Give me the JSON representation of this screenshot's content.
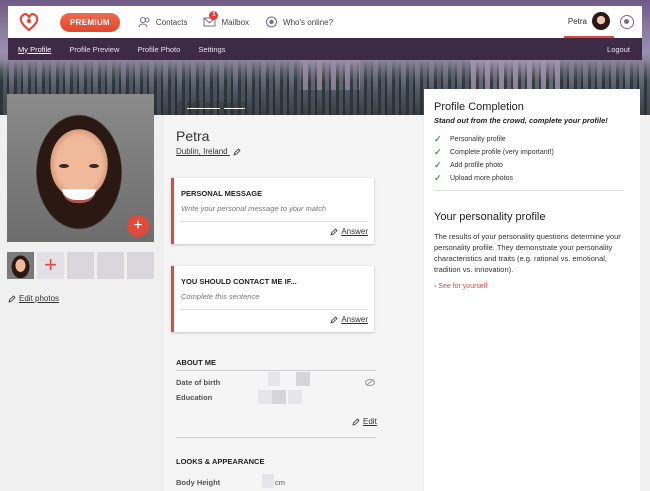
{
  "header": {
    "premium_label": "PREMIUM",
    "nav": [
      {
        "label": "Contacts",
        "icon": "contacts-icon"
      },
      {
        "label": "Mailbox",
        "icon": "mailbox-icon",
        "badge": "1"
      },
      {
        "label": "Who's online?",
        "icon": "whos-online-icon"
      }
    ],
    "user_name": "Petra"
  },
  "subnav": {
    "tabs": [
      "My Profile",
      "Profile Preview",
      "Profile Photo",
      "Settings"
    ],
    "logout": "Logout"
  },
  "profile": {
    "edit_background": "Edit background",
    "name": "Petra",
    "location": "Dublin, Ireland",
    "edit_photos": "Edit photos"
  },
  "cards": [
    {
      "title": "PERSONAL MESSAGE",
      "placeholder": "Write your personal message to your match",
      "action": "Answer"
    },
    {
      "title": "YOU SHOULD CONTACT ME IF...",
      "placeholder": "Complete this sentence",
      "action": "Answer"
    }
  ],
  "about": {
    "heading": "ABOUT ME",
    "date_of_birth": "Date of birth",
    "education": "Education",
    "edit": "Edit"
  },
  "looks": {
    "heading": "LOOKS & APPEARANCE",
    "body_height": "Body Height",
    "body_height_unit": "cm"
  },
  "completion": {
    "title": "Profile Completion",
    "subtitle": "Stand out from the crowd, complete your profile!",
    "items": [
      "Personality profile",
      "Complete profile (very important!)",
      "Add profile photo",
      "Upload more photos"
    ],
    "personality_title": "Your personality profile",
    "personality_desc": "The results of your personality questions determine your personality profile. They demonstrate your personality characteristics and traits (e.g. rational vs. emotional, tradition vs. innovation).",
    "see_link": "See for yourself"
  },
  "colors": {
    "accent": "#e04a3a",
    "nav_bg": "#3c2a47",
    "check": "#3aa64a"
  }
}
